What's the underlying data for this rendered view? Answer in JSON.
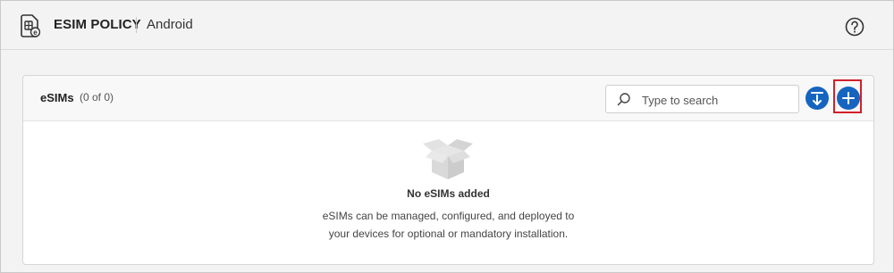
{
  "header": {
    "title": "ESIM POLICY",
    "subtitle": "Android",
    "icons": {
      "app": "sim-card-icon",
      "help": "help-icon"
    }
  },
  "card": {
    "title": "eSIMs",
    "count": "(0 of 0)",
    "search": {
      "placeholder": "Type to search"
    },
    "actions": {
      "export_icon": "download-icon",
      "add_icon": "plus-icon"
    },
    "empty": {
      "title": "No eSIMs added",
      "line1": "eSIMs can be managed, configured, and deployed to",
      "line2": "your devices for optional or mandatory installation.",
      "icon": "empty-box-icon"
    }
  },
  "colors": {
    "accent": "#1565c0",
    "highlight": "#d0202b",
    "header_bg": "#f3f3f3"
  }
}
